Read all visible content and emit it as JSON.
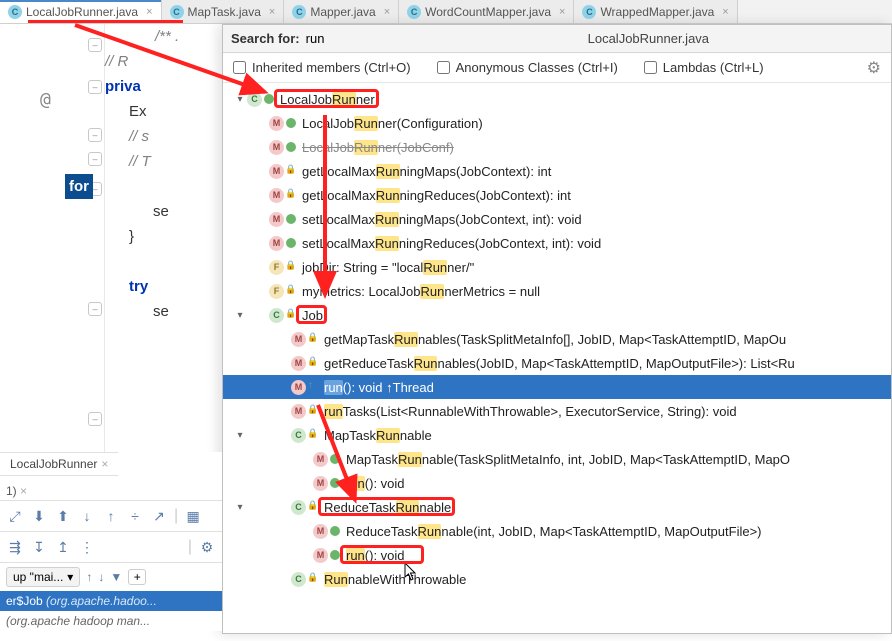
{
  "tabs": [
    {
      "label": "LocalJobRunner.java",
      "active": true
    },
    {
      "label": "MapTask.java",
      "active": false
    },
    {
      "label": "Mapper.java",
      "active": false
    },
    {
      "label": "WordCountMapper.java",
      "active": false
    },
    {
      "label": "WrappedMapper.java",
      "active": false
    }
  ],
  "code": {
    "l1a": "// R",
    "l1b": "",
    "l2": "priva",
    "l3": "Ex",
    "l4": "// s",
    "l5": "// T",
    "l6": "for ",
    "l7": "se",
    "l8": "}",
    "l9": "try ",
    "l10": "se"
  },
  "popup": {
    "search_label": "Search for:",
    "search_value": "run",
    "title": "LocalJobRunner.java",
    "filters": {
      "inherited": "Inherited members (Ctrl+O)",
      "anon": "Anonymous Classes (Ctrl+I)",
      "lambdas": "Lambdas (Ctrl+L)"
    },
    "tree": [
      {
        "depth": 0,
        "expand": "down",
        "icon": "c",
        "viz": "pub",
        "parts": [
          "LocalJob",
          "Run",
          "ner"
        ],
        "boxed": true
      },
      {
        "depth": 1,
        "icon": "m",
        "viz": "pub",
        "parts": [
          "LocalJob",
          "Run",
          "ner(Configuration)"
        ]
      },
      {
        "depth": 1,
        "icon": "m",
        "viz": "pub",
        "parts": [
          "LocalJob",
          "Run",
          "ner(JobConf)"
        ],
        "strike": true
      },
      {
        "depth": 1,
        "icon": "m",
        "viz": "lock",
        "parts": [
          "getLocalMax",
          "Run",
          "ningMaps(JobContext): int"
        ]
      },
      {
        "depth": 1,
        "icon": "m",
        "viz": "lock",
        "parts": [
          "getLocalMax",
          "Run",
          "ningReduces(JobContext): int"
        ]
      },
      {
        "depth": 1,
        "icon": "m",
        "viz": "pub",
        "parts": [
          "setLocalMax",
          "Run",
          "ningMaps(JobContext, int): void"
        ]
      },
      {
        "depth": 1,
        "icon": "m",
        "viz": "pub",
        "parts": [
          "setLocalMax",
          "Run",
          "ningReduces(JobContext, int): void"
        ]
      },
      {
        "depth": 1,
        "icon": "f",
        "viz": "lock",
        "parts": [
          "jobDir: String = \"local",
          "Run",
          "ner/\""
        ]
      },
      {
        "depth": 1,
        "icon": "f",
        "viz": "lock",
        "parts": [
          "myMetrics: LocalJob",
          "Run",
          "nerMetrics = null"
        ]
      },
      {
        "depth": 1,
        "expand": "down",
        "icon": "c",
        "viz": "lock",
        "parts": [
          "Job"
        ],
        "boxed": true
      },
      {
        "depth": 2,
        "icon": "m",
        "viz": "lock",
        "parts": [
          "getMapTask",
          "Run",
          "nables(TaskSplitMetaInfo[], JobID, Map<TaskAttemptID, MapOu"
        ]
      },
      {
        "depth": 2,
        "icon": "m",
        "viz": "lock",
        "parts": [
          "getReduceTask",
          "Run",
          "nables(JobID, Map<TaskAttemptID, MapOutputFile>): List<Ru"
        ]
      },
      {
        "depth": 2,
        "icon": "m",
        "viz": "up",
        "parts": [
          "",
          "run",
          "(): void ↑Thread"
        ],
        "selected": true
      },
      {
        "depth": 2,
        "icon": "m",
        "viz": "lock",
        "parts": [
          "",
          "run",
          "Tasks(List<RunnableWithThrowable>, ExecutorService, String): void"
        ]
      },
      {
        "depth": 2,
        "expand": "down",
        "icon": "c",
        "viz": "lock",
        "parts": [
          "MapTask",
          "Run",
          "nable"
        ]
      },
      {
        "depth": 3,
        "icon": "m",
        "viz": "pub",
        "parts": [
          "MapTask",
          "Run",
          "nable(TaskSplitMetaInfo, int, JobID, Map<TaskAttemptID, MapO"
        ]
      },
      {
        "depth": 3,
        "icon": "m",
        "viz": "pub",
        "parts": [
          "",
          "run",
          "(): void"
        ]
      },
      {
        "depth": 2,
        "expand": "down",
        "icon": "c",
        "viz": "lock",
        "parts": [
          "ReduceTask",
          "Run",
          "nable"
        ],
        "boxed": true
      },
      {
        "depth": 3,
        "icon": "m",
        "viz": "pub",
        "parts": [
          "ReduceTask",
          "Run",
          "nable(int, JobID, Map<TaskAttemptID, MapOutputFile>)"
        ]
      },
      {
        "depth": 3,
        "icon": "m",
        "viz": "pub",
        "parts": [
          "",
          "run",
          "(): void"
        ],
        "boxed_run": true
      },
      {
        "depth": 2,
        "icon": "c",
        "viz": "lock",
        "parts": [
          "",
          "Run",
          "nableWithThrowable"
        ]
      }
    ]
  },
  "bottom": {
    "tab": "LocalJobRunner",
    "panel": "1)",
    "group": "up \"mai...",
    "item_main": "er$Job",
    "item_pkg": "(org.apache.hadoo..."
  }
}
